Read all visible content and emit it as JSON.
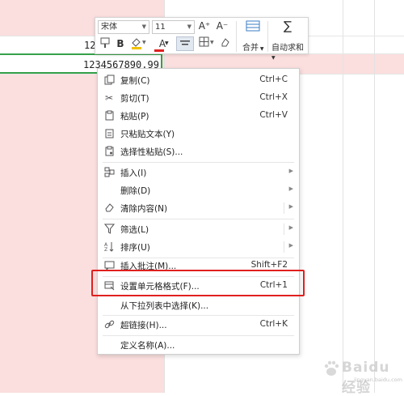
{
  "sheet": {
    "cell_above_value": "12",
    "active_cell_value": "1234567890.99"
  },
  "mini_toolbar": {
    "font_name": "宋体",
    "font_size": "11",
    "bold_label": "B",
    "font_color_label": "A",
    "grow_font_label": "A⁺",
    "shrink_font_label": "A⁻",
    "merge_label": "合并",
    "autosum_label": "自动求和",
    "autosum_icon_glyph": "∑"
  },
  "context_menu": {
    "items": [
      {
        "label": "复制(C)",
        "shortcut": "Ctrl+C",
        "icon": "copy-icon"
      },
      {
        "label": "剪切(T)",
        "shortcut": "Ctrl+X",
        "icon": "scissors-icon"
      },
      {
        "label": "粘贴(P)",
        "shortcut": "Ctrl+V",
        "icon": "paste-icon"
      },
      {
        "label": "只粘贴文本(Y)",
        "shortcut": "",
        "icon": "paste-text-icon"
      },
      {
        "label": "选择性粘贴(S)...",
        "shortcut": "",
        "icon": "paste-special-icon"
      },
      {
        "label": "插入(I)",
        "shortcut": "",
        "icon": "insert-icon",
        "submenu": true
      },
      {
        "label": "删除(D)",
        "shortcut": "",
        "icon": "",
        "submenu": true
      },
      {
        "label": "清除内容(N)",
        "shortcut": "",
        "icon": "clear-icon",
        "submenu": true
      },
      {
        "label": "筛选(L)",
        "shortcut": "",
        "icon": "filter-icon",
        "submenu": true
      },
      {
        "label": "排序(U)",
        "shortcut": "",
        "icon": "sort-icon",
        "submenu": true
      },
      {
        "label": "插入批注(M)...",
        "shortcut": "Shift+F2",
        "icon": "comment-icon"
      },
      {
        "label": "设置单元格格式(F)...",
        "shortcut": "Ctrl+1",
        "icon": "format-cells-icon"
      },
      {
        "label": "从下拉列表中选择(K)...",
        "shortcut": "",
        "icon": ""
      },
      {
        "label": "超链接(H)...",
        "shortcut": "Ctrl+K",
        "icon": "link-icon"
      },
      {
        "label": "定义名称(A)...",
        "shortcut": "",
        "icon": ""
      }
    ]
  },
  "watermark": {
    "text": "Baidu经验",
    "sub_text": "jingyan.baidu.com"
  },
  "colors": {
    "highlight": "#e02020",
    "active_cell_border": "#36a04a",
    "selection_fill": "#fbdede"
  }
}
